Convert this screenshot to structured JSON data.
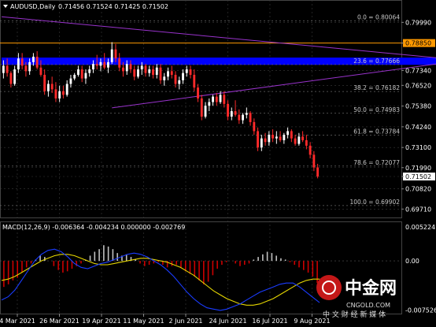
{
  "header": {
    "symbol": "AUDUSD,Daily",
    "ohlc": "0.71456 0.71524 0.71425 0.71502"
  },
  "macd_header": "MACD(12,26,9) -0.006364 -0.004234 0.000000 -0.002769",
  "watermark": {
    "brand": "中金网",
    "domain": "CNGOLD.COM",
    "tagline": "中 文 财 经 新 媒 体"
  },
  "colors": {
    "background": "#000000",
    "grid": "#3a3a3a",
    "candle": "#ffffff",
    "bear_candle": "#ff2a2a",
    "resistance_line": "#ff9900",
    "current_price_box": "#ffffff",
    "zone": "#0000ff",
    "triangle": "#9933cc",
    "macd_pos": "#c0c0c0",
    "macd_neg": "#cc0000",
    "signal": "#e5d600",
    "macd_line": "#1a3cff"
  },
  "chart_data": {
    "type": "candlestick",
    "price_axis": {
      "ylim": [
        0.6942,
        0.8096
      ],
      "tick_labels": [
        "0.79990",
        "0.78850",
        "0.77340",
        "0.76520",
        "0.75380",
        "0.74240",
        "0.73100",
        "0.71990",
        "0.71502",
        "0.70820",
        "0.69710"
      ],
      "highlighted_ticks": [
        "0.78850",
        "0.71502"
      ]
    },
    "macd_axis": {
      "ylim": [
        -0.00785,
        0.00545
      ],
      "tick_labels": [
        "0.005224",
        "0.00",
        "-0.007526"
      ]
    },
    "x_tick_labels": [
      "4 Mar 2021",
      "26 Mar 2021",
      "19 Apr 2021",
      "11 May 2021",
      "2 Jun 2021",
      "24 Jun 2021",
      "16 Jul 2021",
      "9 Aug 2021"
    ],
    "fibonacci": [
      {
        "label": "0.0 = 0.80064",
        "value": 0.80064
      },
      {
        "label": "23.6 = 0.77666",
        "value": 0.77666
      },
      {
        "label": "38.2 = 0.76182",
        "value": 0.76182
      },
      {
        "label": "50.0 = 0.74983",
        "value": 0.74983
      },
      {
        "label": "61.8 = 0.73784",
        "value": 0.73784
      },
      {
        "label": "78.6 = 0.72077",
        "value": 0.72077
      },
      {
        "label": "100.0 = 0.69902",
        "value": 0.69902
      }
    ],
    "resistance_level": 0.7885,
    "current_price": 0.71502,
    "zone": {
      "from": 0.7765,
      "to": 0.7805,
      "x_from_bar": 0,
      "x_to_bar": 130
    },
    "triangle": {
      "upper_from": {
        "bar": 0,
        "value": 0.803
      },
      "upper_to": {
        "bar": 123,
        "value": 0.779
      },
      "lower_from": {
        "bar": 29,
        "value": 0.7528
      },
      "lower_to": {
        "bar": 123,
        "value": 0.779
      }
    },
    "candles": [
      [
        0.772,
        0.779,
        0.769,
        0.776
      ],
      [
        0.776,
        0.78,
        0.77,
        0.772
      ],
      [
        0.772,
        0.773,
        0.764,
        0.766
      ],
      [
        0.766,
        0.776,
        0.765,
        0.774
      ],
      [
        0.774,
        0.783,
        0.772,
        0.78
      ],
      [
        0.78,
        0.783,
        0.774,
        0.776
      ],
      [
        0.776,
        0.778,
        0.77,
        0.773
      ],
      [
        0.773,
        0.78,
        0.771,
        0.778
      ],
      [
        0.778,
        0.783,
        0.776,
        0.781
      ],
      [
        0.781,
        0.784,
        0.774,
        0.775
      ],
      [
        0.775,
        0.779,
        0.77,
        0.771
      ],
      [
        0.771,
        0.774,
        0.76,
        0.762
      ],
      [
        0.762,
        0.768,
        0.759,
        0.766
      ],
      [
        0.766,
        0.77,
        0.761,
        0.763
      ],
      [
        0.763,
        0.767,
        0.756,
        0.758
      ],
      [
        0.758,
        0.765,
        0.756,
        0.762
      ],
      [
        0.762,
        0.765,
        0.758,
        0.76
      ],
      [
        0.76,
        0.768,
        0.759,
        0.766
      ],
      [
        0.766,
        0.771,
        0.764,
        0.769
      ],
      [
        0.769,
        0.772,
        0.768,
        0.771
      ],
      [
        0.771,
        0.776,
        0.77,
        0.774
      ],
      [
        0.774,
        0.776,
        0.767,
        0.769
      ],
      [
        0.769,
        0.774,
        0.766,
        0.772
      ],
      [
        0.772,
        0.776,
        0.77,
        0.774
      ],
      [
        0.774,
        0.779,
        0.772,
        0.777
      ],
      [
        0.777,
        0.782,
        0.774,
        0.776
      ],
      [
        0.776,
        0.78,
        0.773,
        0.778
      ],
      [
        0.778,
        0.783,
        0.774,
        0.775
      ],
      [
        0.775,
        0.78,
        0.772,
        0.778
      ],
      [
        0.778,
        0.789,
        0.777,
        0.785
      ],
      [
        0.785,
        0.788,
        0.778,
        0.78
      ],
      [
        0.78,
        0.783,
        0.773,
        0.775
      ],
      [
        0.775,
        0.778,
        0.77,
        0.773
      ],
      [
        0.773,
        0.779,
        0.771,
        0.777
      ],
      [
        0.777,
        0.779,
        0.772,
        0.774
      ],
      [
        0.774,
        0.776,
        0.768,
        0.77
      ],
      [
        0.77,
        0.776,
        0.769,
        0.774
      ],
      [
        0.774,
        0.778,
        0.771,
        0.776
      ],
      [
        0.776,
        0.777,
        0.77,
        0.772
      ],
      [
        0.772,
        0.776,
        0.77,
        0.774
      ],
      [
        0.774,
        0.776,
        0.769,
        0.771
      ],
      [
        0.771,
        0.777,
        0.769,
        0.775
      ],
      [
        0.775,
        0.777,
        0.766,
        0.768
      ],
      [
        0.768,
        0.772,
        0.765,
        0.77
      ],
      [
        0.77,
        0.775,
        0.768,
        0.773
      ],
      [
        0.773,
        0.776,
        0.769,
        0.771
      ],
      [
        0.771,
        0.773,
        0.764,
        0.766
      ],
      [
        0.766,
        0.77,
        0.763,
        0.768
      ],
      [
        0.768,
        0.774,
        0.766,
        0.772
      ],
      [
        0.772,
        0.776,
        0.77,
        0.774
      ],
      [
        0.774,
        0.776,
        0.769,
        0.771
      ],
      [
        0.771,
        0.774,
        0.762,
        0.764
      ],
      [
        0.764,
        0.766,
        0.756,
        0.758
      ],
      [
        0.758,
        0.76,
        0.746,
        0.748
      ],
      [
        0.748,
        0.756,
        0.747,
        0.754
      ],
      [
        0.754,
        0.758,
        0.751,
        0.756
      ],
      [
        0.756,
        0.76,
        0.754,
        0.759
      ],
      [
        0.759,
        0.761,
        0.754,
        0.756
      ],
      [
        0.756,
        0.762,
        0.755,
        0.76
      ],
      [
        0.76,
        0.762,
        0.753,
        0.755
      ],
      [
        0.755,
        0.757,
        0.746,
        0.748
      ],
      [
        0.748,
        0.753,
        0.746,
        0.751
      ],
      [
        0.751,
        0.757,
        0.748,
        0.749
      ],
      [
        0.749,
        0.752,
        0.744,
        0.746
      ],
      [
        0.746,
        0.75,
        0.744,
        0.749
      ],
      [
        0.749,
        0.753,
        0.747,
        0.75
      ],
      [
        0.75,
        0.751,
        0.743,
        0.745
      ],
      [
        0.745,
        0.747,
        0.738,
        0.74
      ],
      [
        0.74,
        0.742,
        0.729,
        0.731
      ],
      [
        0.731,
        0.738,
        0.729,
        0.736
      ],
      [
        0.736,
        0.739,
        0.732,
        0.734
      ],
      [
        0.734,
        0.74,
        0.732,
        0.738
      ],
      [
        0.738,
        0.741,
        0.734,
        0.736
      ],
      [
        0.736,
        0.74,
        0.733,
        0.737
      ],
      [
        0.737,
        0.74,
        0.734,
        0.735
      ],
      [
        0.735,
        0.739,
        0.733,
        0.738
      ],
      [
        0.738,
        0.742,
        0.736,
        0.74
      ],
      [
        0.74,
        0.741,
        0.734,
        0.736
      ],
      [
        0.736,
        0.738,
        0.732,
        0.733
      ],
      [
        0.733,
        0.739,
        0.732,
        0.737
      ],
      [
        0.737,
        0.74,
        0.734,
        0.735
      ],
      [
        0.735,
        0.738,
        0.73,
        0.732
      ],
      [
        0.732,
        0.734,
        0.725,
        0.727
      ],
      [
        0.727,
        0.729,
        0.718,
        0.72
      ],
      [
        0.72,
        0.722,
        0.714,
        0.715
      ]
    ],
    "macd": {
      "histogram": [
        -0.004,
        -0.0036,
        -0.003,
        -0.0026,
        -0.0018,
        -0.001,
        -0.0004,
        0.0002,
        0.0008,
        0.0006,
        0.0,
        -0.0008,
        -0.0014,
        -0.0018,
        -0.0016,
        -0.0012,
        -0.0008,
        -0.0004,
        0.0002,
        0.0008,
        0.0014,
        0.0018,
        0.0024,
        0.0022,
        0.0018,
        0.0012,
        0.0008,
        0.001,
        0.0006,
        0.0002,
        -0.0004,
        -0.0008,
        -0.0006,
        -0.0004,
        -0.0002,
        -0.0006,
        -0.001,
        -0.0008,
        -0.0006,
        -0.001,
        -0.0016,
        -0.002,
        -0.0024,
        -0.003,
        -0.0036,
        -0.0032,
        -0.0022,
        -0.0012,
        -0.0006,
        -0.0002,
        0.0,
        -0.0004,
        -0.0008,
        -0.0006,
        -0.0004,
        0.0002,
        0.0006,
        0.001,
        0.0014,
        0.0012,
        0.0008,
        0.0004,
        0.0002,
        -0.0002,
        -0.0006,
        -0.001,
        -0.0014,
        -0.0018,
        -0.0024,
        -0.0034
      ],
      "signal": [
        -0.003,
        -0.0028,
        -0.0024,
        -0.0018,
        -0.0012,
        -0.0006,
        0.0,
        0.0004,
        0.0008,
        0.001,
        0.001,
        0.0008,
        0.0004,
        0.0,
        -0.0004,
        -0.0006,
        -0.0006,
        -0.0004,
        -0.0002,
        0.0,
        0.0002,
        0.0004,
        0.0004,
        0.0002,
        0.0,
        -0.0002,
        -0.0006,
        -0.001,
        -0.0016,
        -0.0022,
        -0.003,
        -0.0038,
        -0.0046,
        -0.0052,
        -0.0058,
        -0.0062,
        -0.0066,
        -0.0068,
        -0.0068,
        -0.0066,
        -0.0062,
        -0.0058,
        -0.0052,
        -0.0046,
        -0.004,
        -0.0034,
        -0.003,
        -0.0028,
        -0.0028
      ],
      "macd_line": [
        -0.006,
        -0.0055,
        -0.0045,
        -0.003,
        -0.0015,
        0.0,
        0.001,
        0.0016,
        0.0018,
        0.0014,
        0.0006,
        -0.0004,
        -0.001,
        -0.0012,
        -0.0008,
        -0.0004,
        -0.0002,
        0.0002,
        0.0006,
        0.001,
        0.0012,
        0.001,
        0.0006,
        0.0,
        -0.0006,
        -0.0014,
        -0.0024,
        -0.0036,
        -0.0048,
        -0.0058,
        -0.0066,
        -0.0072,
        -0.0074,
        -0.0076,
        -0.0074,
        -0.007,
        -0.0066,
        -0.006,
        -0.0054,
        -0.0048,
        -0.0044,
        -0.004,
        -0.0036,
        -0.0034,
        -0.0034,
        -0.004,
        -0.0048,
        -0.0056,
        -0.0064
      ]
    }
  }
}
